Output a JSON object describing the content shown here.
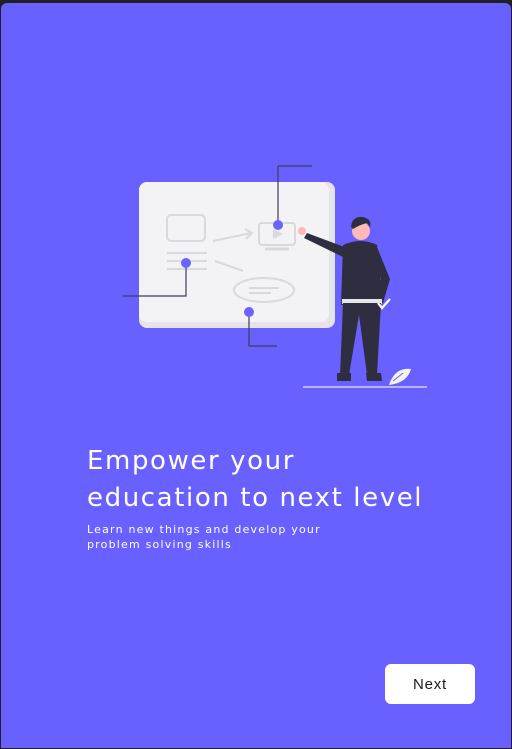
{
  "onboarding": {
    "illustration": "person-presenting-whiteboard-illustration",
    "title_line1": "Empower your",
    "title_line2": "education to next level",
    "subtitle_line1": "Learn new things and develop your",
    "subtitle_line2": "problem solving skills",
    "next_label": "Next"
  },
  "colors": {
    "background": "#6961ff",
    "accent_dot": "#6c63ff",
    "button_bg": "#ffffff",
    "text": "#ffffff"
  }
}
